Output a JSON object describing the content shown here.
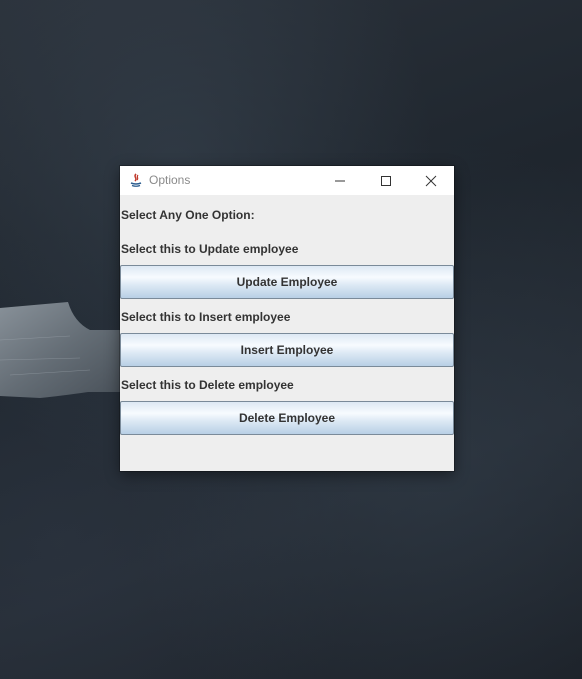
{
  "window": {
    "title": "Options",
    "controls": {
      "minimize_icon": "minimize-icon",
      "maximize_icon": "maximize-icon",
      "close_icon": "close-icon"
    }
  },
  "content": {
    "heading": "Select Any One Option:",
    "update": {
      "label": "Select this to Update employee",
      "button": "Update Employee"
    },
    "insert": {
      "label": "Select this to Insert employee",
      "button": "Insert Employee"
    },
    "delete": {
      "label": "Select this to Delete employee",
      "button": "Delete Employee"
    }
  },
  "colors": {
    "window_bg": "#eeeeee",
    "text": "#333333",
    "button_border": "#7a8a99",
    "button_gradient_top": "#dde8f3",
    "button_gradient_bottom": "#b8cfe5"
  }
}
